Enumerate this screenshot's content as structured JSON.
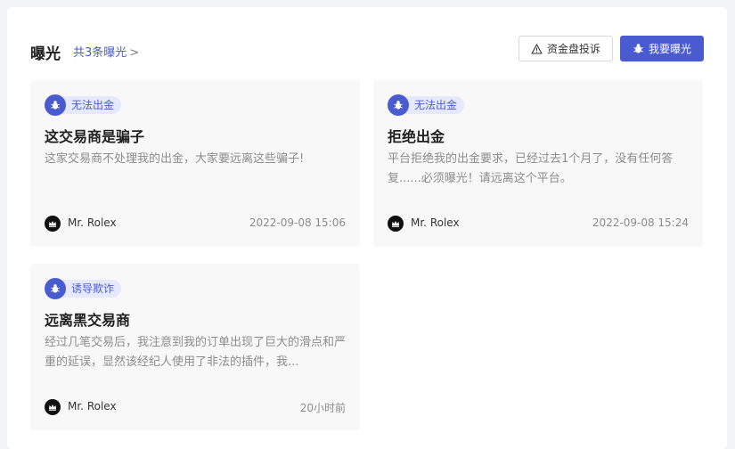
{
  "header": {
    "title": "曝光",
    "count_link": "共3条曝光",
    "complaint_button": "资金盘投诉",
    "expose_button": "我要曝光"
  },
  "colors": {
    "accent": "#4a5bd0",
    "tag_bg": "#e6e9fb"
  },
  "cards": [
    {
      "tag": "无法出金",
      "title": "这交易商是骗子",
      "desc": "这家交易商不处理我的出金，大家要远离这些骗子!",
      "user": "Mr. Rolex",
      "time": "2022-09-08 15:06"
    },
    {
      "tag": "无法出金",
      "title": "拒绝出金",
      "desc": "平台拒绝我的出金要求，已经过去1个月了，没有任何答复......必须曝光！请远离这个平台。",
      "user": "Mr. Rolex",
      "time": "2022-09-08 15:24"
    },
    {
      "tag": "诱导欺诈",
      "title": "远离黑交易商",
      "desc": "经过几笔交易后，我注意到我的订单出现了巨大的滑点和严重的延误，显然该经纪人使用了非法的插件，我...",
      "user": "Mr. Rolex",
      "time": "20小时前"
    }
  ]
}
